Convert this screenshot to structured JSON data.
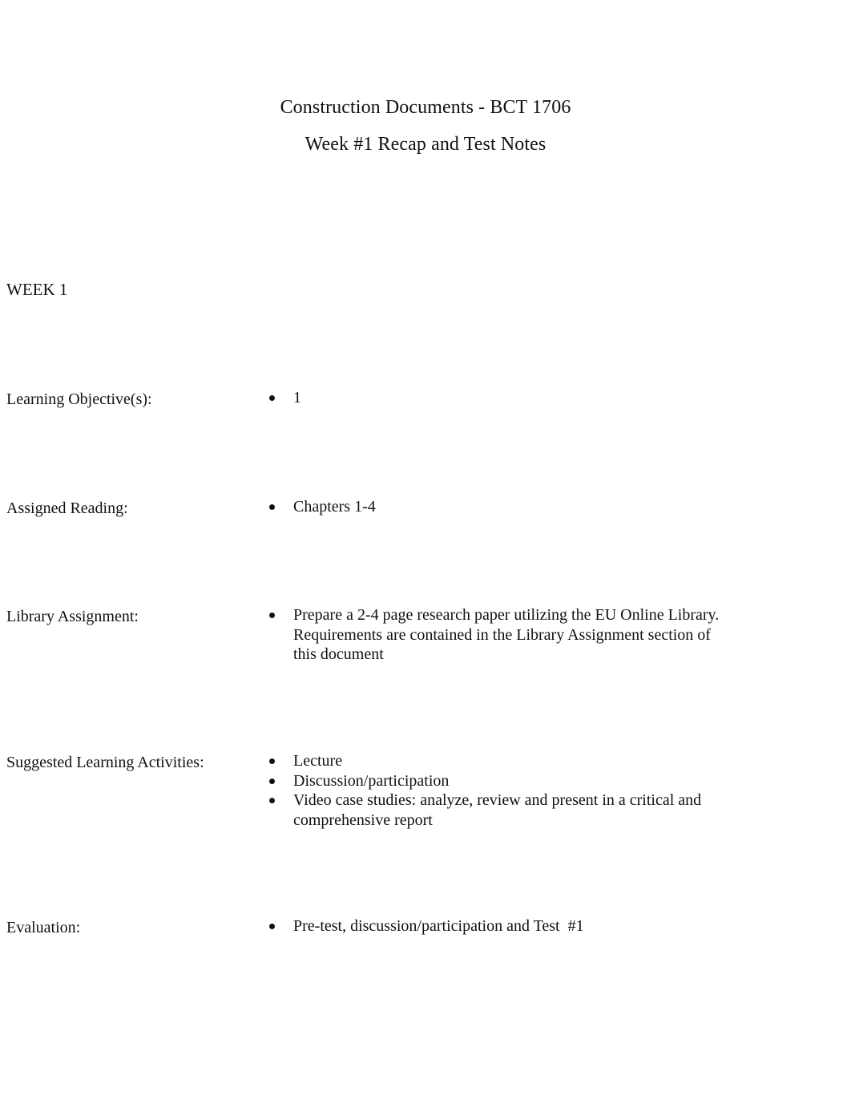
{
  "document": {
    "title": "Construction Documents - BCT 1706",
    "subtitle": "Week #1 Recap and Test Notes",
    "section_heading": "WEEK 1"
  },
  "rows": [
    {
      "id": "objectives",
      "label": "Learning Objective(s):",
      "items": [
        "1"
      ]
    },
    {
      "id": "reading",
      "label": "Assigned Reading:",
      "items": [
        "Chapters 1-4"
      ]
    },
    {
      "id": "library",
      "label": "Library Assignment:",
      "items": [
        "Prepare a 2-4 page research paper utilizing the EU Online Library. Requirements are contained in the Library Assignment section of this document"
      ]
    },
    {
      "id": "activities",
      "label": "Suggested Learning Activities:",
      "items": [
        "Lecture",
        "Discussion/participation",
        "Video case studies: analyze, review and present in a critical and comprehensive report"
      ]
    },
    {
      "id": "evaluation",
      "label": "Evaluation:",
      "items": [
        "Pre-test, discussion/participation and Test  #1"
      ]
    }
  ],
  "colors": {
    "page_background": "#ffffff",
    "text": "#111111",
    "bullet": "#111111"
  }
}
